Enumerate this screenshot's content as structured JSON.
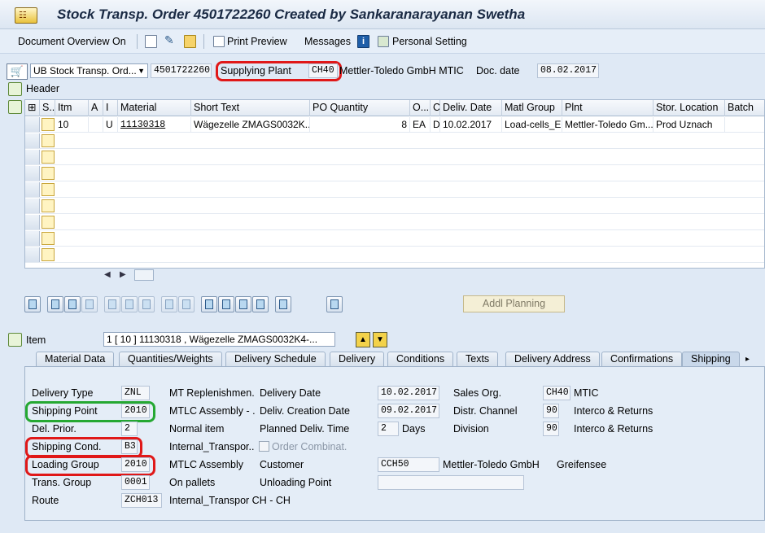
{
  "title": "Stock Transp. Order 4501722260 Created by Sankaranarayanan Swetha",
  "toolbar": {
    "document_overview": "Document Overview On",
    "print_preview": "Print Preview",
    "messages": "Messages",
    "personal_setting": "Personal Setting"
  },
  "header": {
    "doc_type": "UB Stock Transp. Ord...",
    "po_number": "4501722260",
    "supplying_plant_label": "Supplying Plant",
    "supplying_plant_value": "CH40",
    "supplying_plant_name": "Mettler-Toledo GmbH MTIC",
    "doc_date_label": "Doc. date",
    "doc_date_value": "08.02.2017",
    "header_label": "Header"
  },
  "grid": {
    "columns": [
      "S..",
      "Itm",
      "A",
      "I",
      "Material",
      "Short Text",
      "PO Quantity",
      "O...",
      "C",
      "Deliv. Date",
      "Matl Group",
      "Plnt",
      "Stor. Location",
      "Batch"
    ],
    "rows": [
      {
        "itm": "10",
        "a": "",
        "i": "U",
        "material": "11130318",
        "short_text": "Wägezelle ZMAGS0032K...",
        "po_qty": "8",
        "oun": "EA",
        "c": "D",
        "deliv_date": "10.02.2017",
        "matl_group": "Load-cells_El...",
        "plnt": "Mettler-Toledo Gm...",
        "sloc": "Prod Uznach",
        "batch": ""
      }
    ]
  },
  "buttons": {
    "addl_planning": "Addl Planning"
  },
  "item": {
    "label": "Item",
    "selector": "1 [ 10 ] 11130318 , Wägezelle ZMAGS0032K4-..."
  },
  "tabs": [
    "Material Data",
    "Quantities/Weights",
    "Delivery Schedule",
    "Delivery",
    "Conditions",
    "Texts",
    "Delivery Address",
    "Confirmations",
    "Shipping"
  ],
  "shipping": {
    "col1": [
      {
        "label": "Delivery Type",
        "value": "ZNL",
        "desc": "MT Replenishmen..."
      },
      {
        "label": "Shipping Point",
        "value": "2010",
        "desc": "MTLC Assembly - ..."
      },
      {
        "label": "Del. Prior.",
        "value": "2",
        "desc": "Normal item"
      },
      {
        "label": "Shipping Cond.",
        "value": "B3",
        "desc": "Internal_Transpor..."
      },
      {
        "label": "Loading Group",
        "value": "2010",
        "desc": "MTLC Assembly"
      },
      {
        "label": "Trans. Group",
        "value": "0001",
        "desc": "On pallets"
      },
      {
        "label": "Route",
        "value": "ZCH013",
        "desc": "Internal_Transpor CH - CH"
      }
    ],
    "delivery_date_label": "Delivery Date",
    "delivery_date": "10.02.2017",
    "deliv_creation_label": "Deliv. Creation Date",
    "deliv_creation": "09.02.2017",
    "planned_deliv_label": "Planned Deliv. Time",
    "planned_deliv": "2",
    "days": "Days",
    "order_combinat": "Order Combinat.",
    "customer_label": "Customer",
    "customer": "CCH50",
    "customer_name": "Mettler-Toledo GmbH",
    "customer_city": "Greifensee",
    "unloading_label": "Unloading Point",
    "sales_org_label": "Sales Org.",
    "sales_org": "CH40",
    "sales_org_desc": "MTIC",
    "distr_label": "Distr. Channel",
    "distr": "90",
    "distr_desc": "Interco & Returns",
    "division_label": "Division",
    "division": "90",
    "division_desc": "Interco & Returns"
  }
}
